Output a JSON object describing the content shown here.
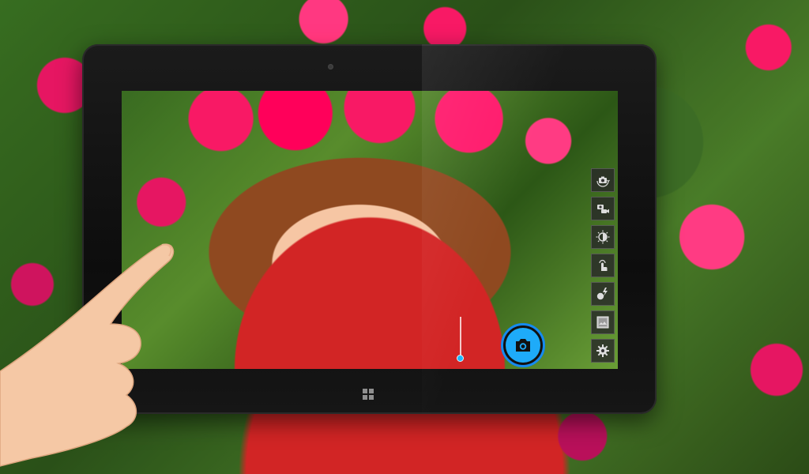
{
  "device": {
    "type": "tablet",
    "os_button_icon": "windows-logo-icon",
    "accent_color": "#29a9f0"
  },
  "camera_app": {
    "toolbar": [
      {
        "id": "switch-camera",
        "icon": "camera-rotate-icon"
      },
      {
        "id": "video-mode",
        "icon": "video-camera-icon"
      },
      {
        "id": "exposure",
        "icon": "brightness-icon"
      },
      {
        "id": "touch-focus",
        "icon": "touch-focus-icon"
      },
      {
        "id": "flash",
        "icon": "flash-icon"
      },
      {
        "id": "gallery",
        "icon": "gallery-thumbnail-icon"
      },
      {
        "id": "settings",
        "icon": "gear-icon"
      }
    ],
    "shutter_icon": "camera-icon",
    "zoom_level": 0.0
  }
}
